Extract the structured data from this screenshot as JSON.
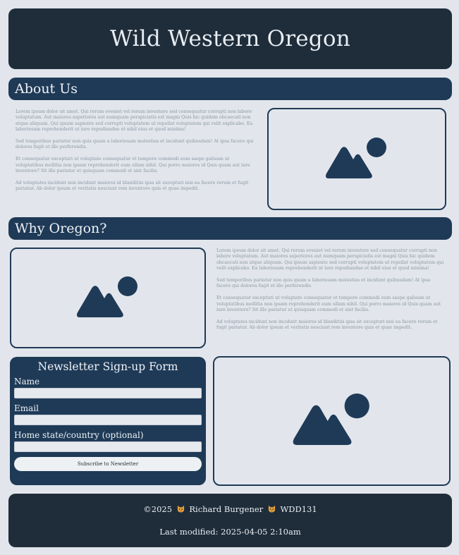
{
  "site": {
    "title": "Wild Western Oregon"
  },
  "about": {
    "heading": "About Us",
    "paragraphs": [
      "Lorem ipsum dolor sit amet. Qui rerum eveniet vel rerum inventore sed consequatur corrupti non labore voluptatum. Aut maiores asperiores aut numquam perspiciatis est magni Quis hic quidem obcaecati non atque aliquam. Qui ipsum sapiente sed corrupti voluptatem ut repellat voluptatem qui velit explicabo. Ea laboriosam reprehenderit ut iure repudiandae et nihil eius et quod minima!",
      "Sed temporibus pariatur non quis quam a laboriosam molestias et incidunt quibusdam! At ipsa facere qui dolores fugit et illo perferendis.",
      "Et consequatur excepturi ut voluptate consequatur et tempore commodi eum saepe galisum ut voluptatibus mollitia non ipsam reprehenderit eum ullam nihil. Qui porro maiores id Quis quam aut iure inventore? Sit illo pariatur et quisquam commodi et sint facilis.",
      "Ad voluptates incidunt non incidunt maiores id blanditiis ipsa sit excepturi nisi ea facere rerum et fugit pariatur. Ab dolor ipsum et veritatis nesciunt rem inventore quis et quae impedit."
    ],
    "image_icon": "image-placeholder-icon"
  },
  "why": {
    "heading": "Why Oregon?",
    "paragraphs": [
      "Lorem ipsum dolor sit amet. Qui rerum eveniet vel rerum inventore sed consequatur corrupti non labore voluptatum. Aut maiores asperiores aut numquam perspiciatis est magni Quis hic quidem obcaecati non atque aliquam. Qui ipsum sapiente sed corrupti voluptatem ut repellat voluptatem qui velit explicabo. Ea laboriosam reprehenderit ut iure repudiandae et nihil eius et quod minima!",
      "Sed temporibus pariatur non quis quam a laboriosam molestias et incidunt quibusdam! At ipsa facere qui dolores fugit et illo perferendis.",
      "Et consequatur excepturi ut voluptate consequatur et tempore commodi eum saepe galisum ut voluptatibus mollitia non ipsam reprehenderit eum ullam nihil. Qui porro maiores id Quis quam aut iure inventore? Sit illo pariatur et quisquam commodi et sint facilis.",
      "Ad voluptates incidunt non incidunt maiores id blanditiis ipsa sit excepturi nisi ea facere rerum et fugit pariatur. Ab dolor ipsum et veritatis nesciunt rem inventore quis et quae impedit."
    ],
    "image_icon": "image-placeholder-icon"
  },
  "newsletter": {
    "title": "Newsletter Sign-up Form",
    "name_label": "Name",
    "email_label": "Email",
    "home_label": "Home state/country (optional)",
    "name_value": "",
    "email_value": "",
    "home_value": "",
    "submit_label": "Subscribe to Newsletter"
  },
  "footer": {
    "copyright": "©2025",
    "author": "Richard Burgener",
    "course": "WDD131",
    "separator_icon": "cat-face-icon",
    "last_modified": "Last modified: 2025-04-05 2:10am"
  },
  "colors": {
    "page_bg": "#e2e6ec",
    "header_bg": "#1f2d3a",
    "accent": "#1f3a57",
    "body_text": "#8b95a2",
    "emoji": "#e8a23a"
  }
}
